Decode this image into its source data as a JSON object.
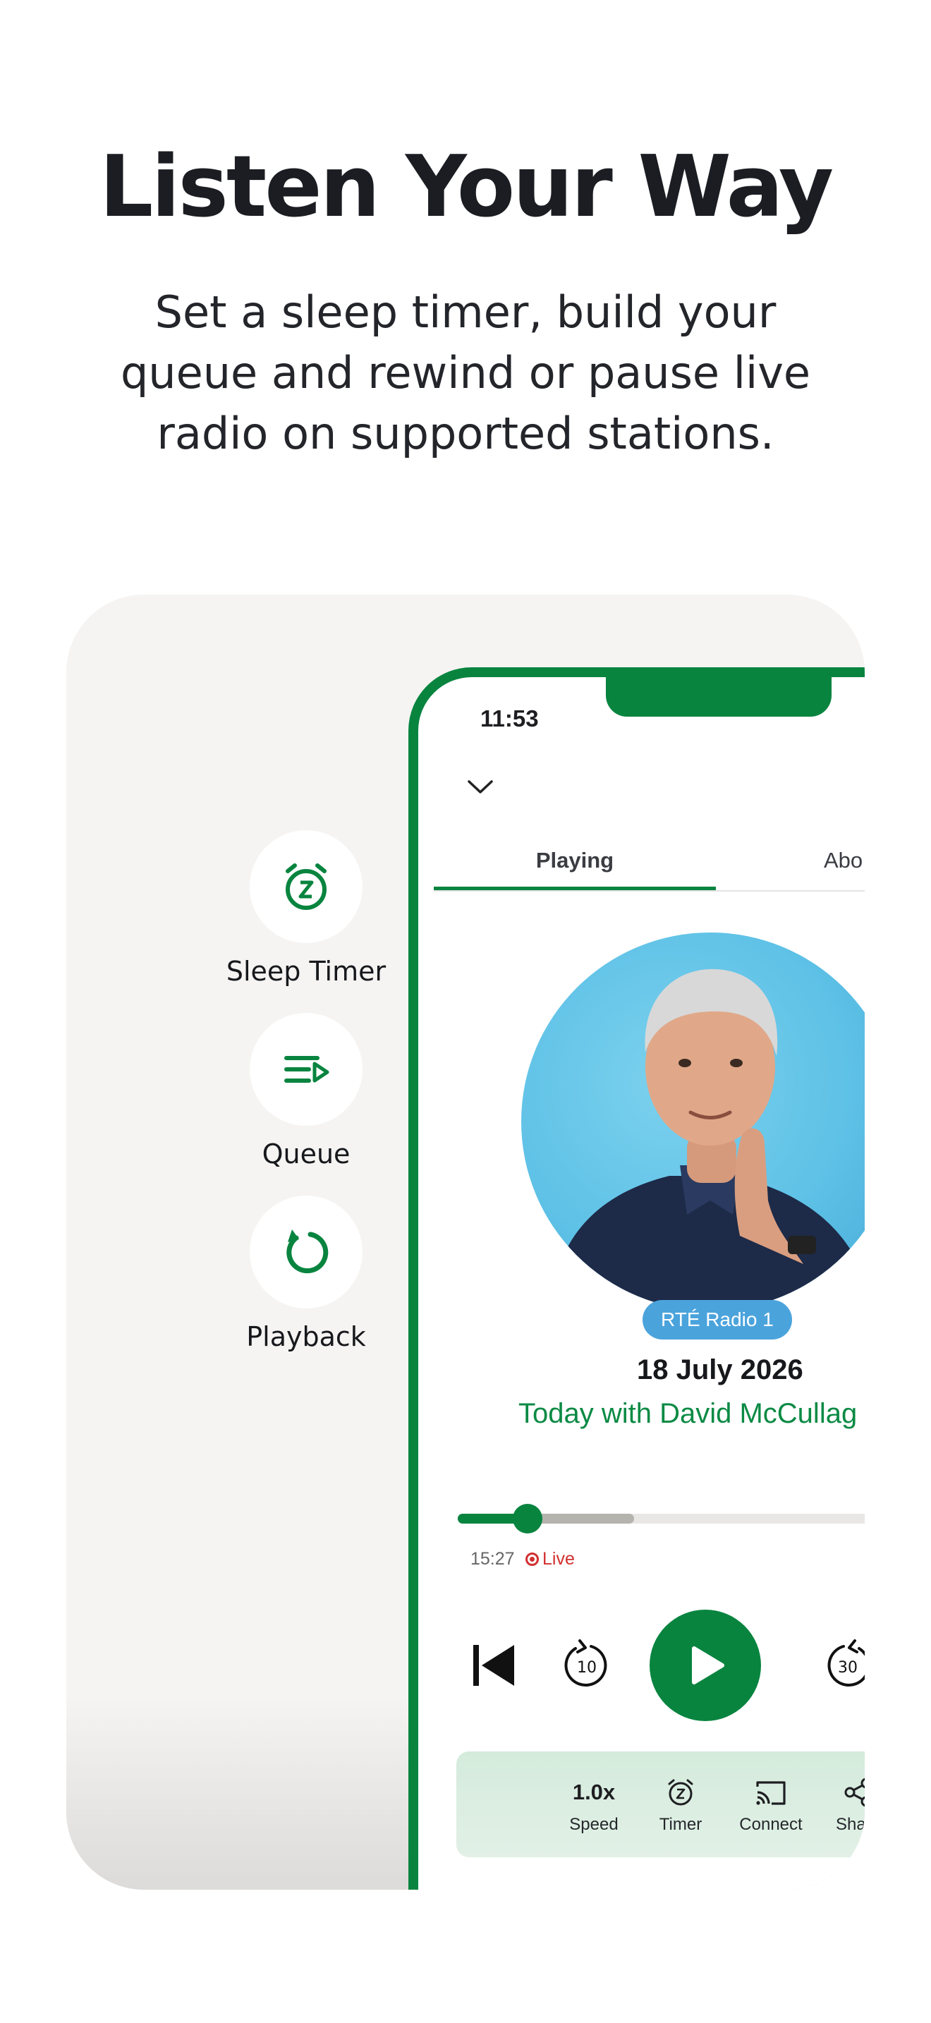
{
  "headline": "Listen Your Way",
  "subhead_lines": [
    "Set a sleep timer, build your",
    "queue and rewind or pause live",
    "radio on supported stations."
  ],
  "features": [
    {
      "label": "Sleep Timer",
      "icon": "alarm-clock-z-icon"
    },
    {
      "label": "Queue",
      "icon": "queue-play-icon"
    },
    {
      "label": "Playback",
      "icon": "replay-icon"
    }
  ],
  "phone": {
    "time": "11:53",
    "tabs": [
      {
        "label": "Playing",
        "active": true
      },
      {
        "label": "Abo",
        "active": false
      }
    ],
    "station": "RTÉ Radio 1",
    "episode_date": "18 July 2026",
    "show_title": "Today with David McCullag",
    "progress": {
      "played_fraction": 0.08,
      "buffered_fraction": 0.27
    },
    "elapsed": "15:27",
    "live_label": "Live",
    "controls": [
      "skip-previous-icon",
      "rewind-10-icon",
      "play-icon",
      "forward-30-icon"
    ],
    "rewind_seconds": "10",
    "forward_seconds": "30",
    "bottom_bar": [
      {
        "value": "1.0x",
        "label": "Speed"
      },
      {
        "icon": "timer-icon",
        "label": "Timer"
      },
      {
        "icon": "cast-icon",
        "label": "Connect"
      },
      {
        "icon": "share-icon",
        "label": "Share"
      }
    ]
  },
  "colors": {
    "accent_green": "#08843f",
    "live_red": "#d12f2f",
    "badge_blue": "#4ba3dc",
    "card_bg": "#f5f4f2"
  }
}
